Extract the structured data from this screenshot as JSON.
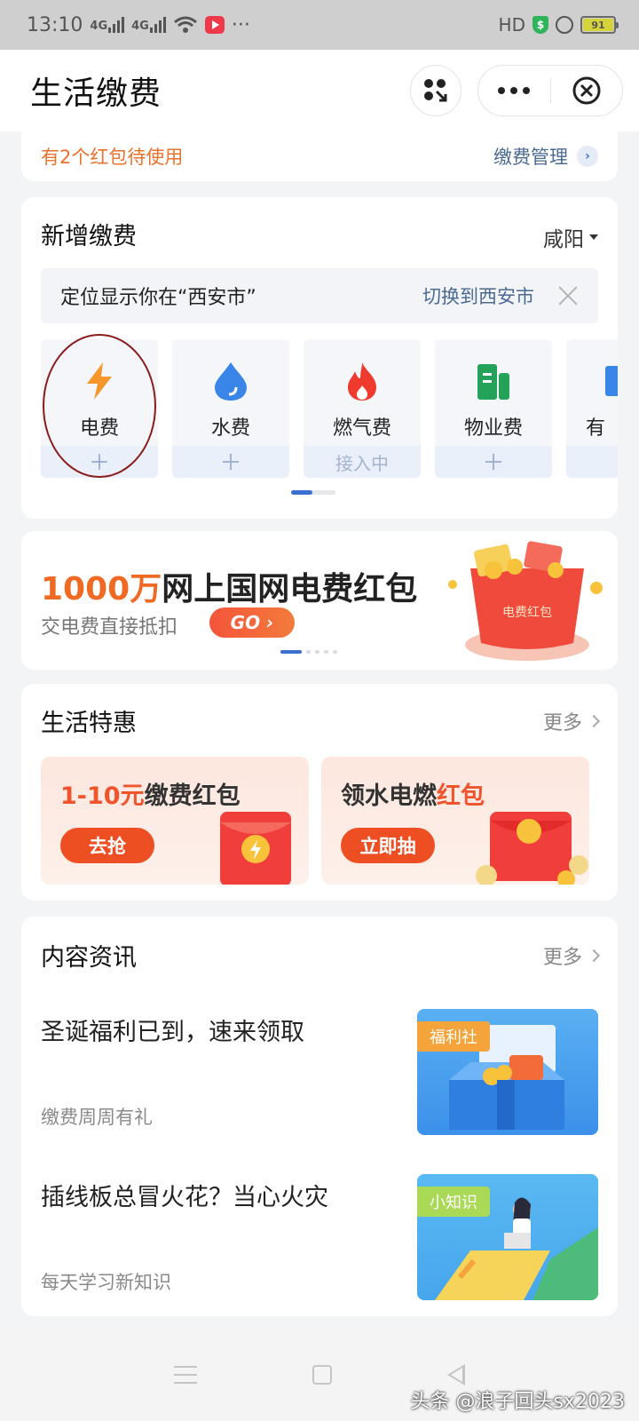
{
  "status_bar": {
    "time": "13:10",
    "net_1": "4G",
    "net_2": "4G",
    "more": "···",
    "hd": "HD",
    "shield": "$",
    "battery": "91"
  },
  "header": {
    "title": "生活缴费"
  },
  "red_packet_bar": {
    "text": "有2个红包待使用",
    "manage_label": "缴费管理"
  },
  "new_payment": {
    "title": "新增缴费",
    "city": "咸阳",
    "locate_text": "定位显示你在“西安市”",
    "switch_label": "切换到西安市",
    "tiles": [
      {
        "label": "电费",
        "icon": "lightning-icon"
      },
      {
        "label": "水费",
        "icon": "water-drop-icon"
      },
      {
        "label": "燃气费",
        "icon": "flame-icon",
        "status": "接入中"
      },
      {
        "label": "物业费",
        "icon": "building-icon"
      },
      {
        "label": "有线",
        "icon": "tv-icon"
      }
    ]
  },
  "banner": {
    "title_num": "1000万",
    "title_rest": "网上国网电费红包",
    "subtitle": "交电费直接抵扣",
    "go_label": "GO",
    "art_label": "电费红包"
  },
  "deals": {
    "title": "生活特惠",
    "more": "更多",
    "items": [
      {
        "title_hl": "1-10元",
        "title_rest": "缴费红包",
        "button": "去抢"
      },
      {
        "title_pre": "领水电燃",
        "title_hl": "红包",
        "button": "立即抽"
      }
    ]
  },
  "news": {
    "title": "内容资讯",
    "more": "更多",
    "items": [
      {
        "title": "圣诞福利已到，速来领取",
        "sub": "缴费周周有礼",
        "tag": "福利社"
      },
      {
        "title": "插线板总冒火花？当心火灾",
        "sub": "每天学习新知识",
        "tag": "小知识"
      }
    ]
  },
  "watermark": "头条 @浪子回头sx2023",
  "colors": {
    "accent_blue": "#3b6fd0",
    "orange": "#f06a24",
    "red_circle": "#8b1c1c"
  }
}
